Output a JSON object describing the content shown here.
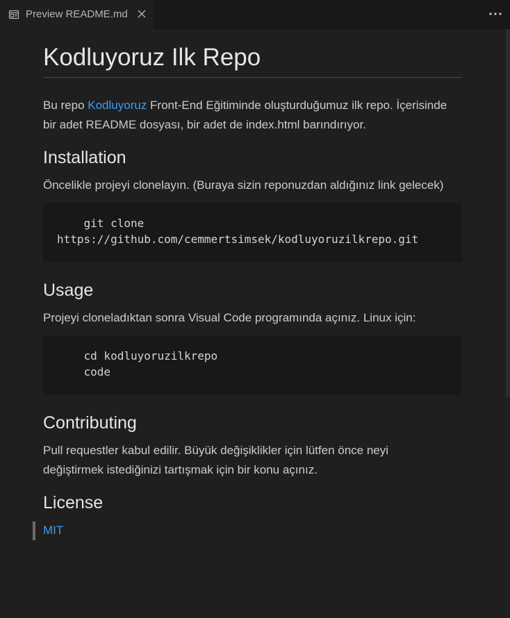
{
  "tab": {
    "title": "Preview README.md",
    "icon": "preview-icon"
  },
  "header_actions": {
    "more_icon": "ellipsis-icon"
  },
  "doc": {
    "title": "Kodluyoruz Ilk Repo",
    "intro": {
      "before_link": "Bu repo ",
      "link_text": "Kodluyoruz",
      "after_link_line1": " Front-End Eğitiminde oluşturduğumuz ilk repo. İçerisinde",
      "line2": "bir adet README dosyası, bir adet de index.html barındırıyor."
    },
    "installation": {
      "heading": "Installation",
      "text": "Öncelikle projeyi clonelayın. (Buraya sizin reponuzdan aldığınız link gelecek)",
      "code_lines": [
        "    git clone",
        "https://github.com/cemmertsimsek/kodluyoruzilkrepo.git"
      ]
    },
    "usage": {
      "heading": "Usage",
      "text": "Projeyi cloneladıktan sonra Visual Code programında açınız. Linux için:",
      "code_lines": [
        "    cd kodluyoruzilkrepo",
        "    code"
      ]
    },
    "contributing": {
      "heading": "Contributing",
      "line1": "Pull requestler kabul edilir. Büyük değişiklikler için lütfen önce neyi",
      "line2": "değiştirmek istediğinizi tartışmak için bir konu açınız."
    },
    "license": {
      "heading": "License",
      "link_text": "MIT"
    }
  },
  "colors": {
    "background": "#1f1f1f",
    "link": "#3e9bf0",
    "code_background": "#181818"
  }
}
